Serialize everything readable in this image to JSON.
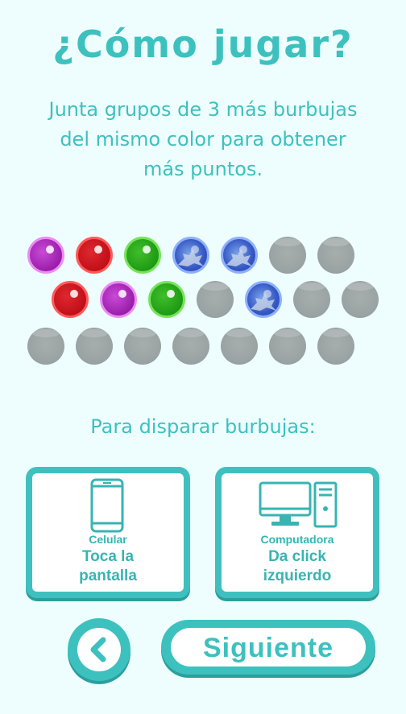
{
  "header": {
    "title": "¿Cómo jugar?",
    "subtitle": "Junta grupos de 3 más burbujas del mismo color para obtener más puntos."
  },
  "board": {
    "rows": [
      [
        "purple",
        "red",
        "green",
        "blue-cracked",
        "blue-cracked",
        "empty",
        "empty"
      ],
      [
        "red",
        "purple",
        "green",
        "empty",
        "blue-cracked",
        "empty",
        "empty"
      ],
      [
        "empty",
        "empty",
        "empty",
        "empty",
        "empty",
        "empty",
        "empty"
      ]
    ]
  },
  "instructions": {
    "label": "Para disparar burbujas:",
    "mobile": {
      "device": "Celular",
      "action_line1": "Toca la",
      "action_line2": "pantalla",
      "icon": "phone-icon"
    },
    "desktop": {
      "device": "Computadora",
      "action_line1": "Da click",
      "action_line2": "izquierdo",
      "icon": "computer-icon"
    }
  },
  "nav": {
    "back_icon": "chevron-left-icon",
    "next_label": "Siguiente"
  },
  "colors": {
    "accent": "#3dc1bf",
    "background": "#eefefe",
    "purple": "#9b1eab",
    "red": "#c01018",
    "green": "#1f9a15",
    "blue": "#3557c4",
    "empty": "#9aa3a3"
  }
}
